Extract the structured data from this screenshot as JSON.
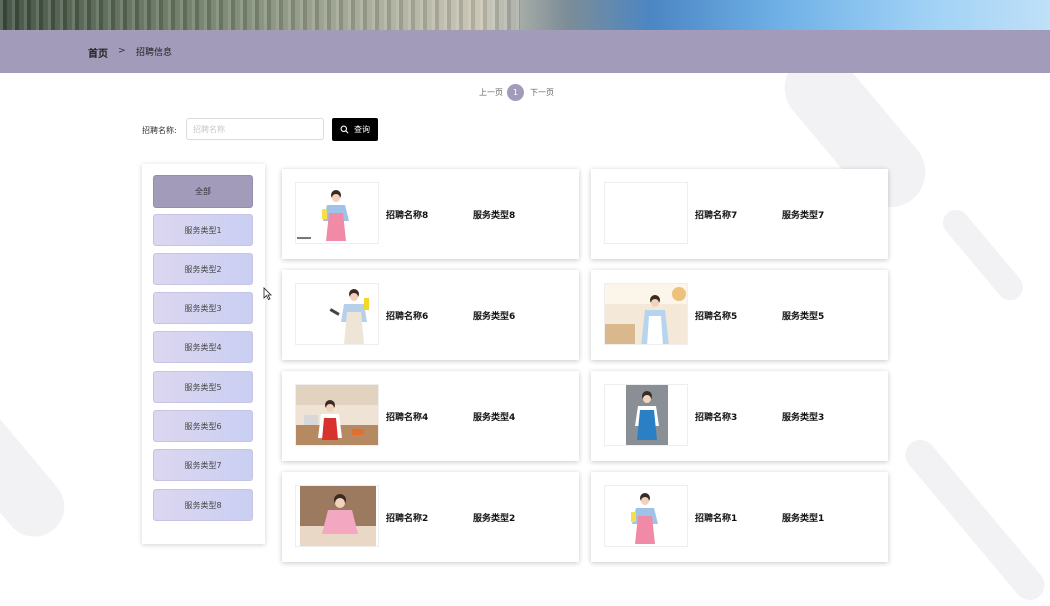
{
  "breadcrumb": {
    "home": "首页",
    "separator": ">",
    "current": "招聘信息"
  },
  "pagination": {
    "prev": "上一页",
    "current_page": "1",
    "next": "下一页"
  },
  "search": {
    "label": "招聘名称:",
    "placeholder": "招聘名称",
    "value": "",
    "button": "查询"
  },
  "categories": [
    "全部",
    "服务类型1",
    "服务类型2",
    "服务类型3",
    "服务类型4",
    "服务类型5",
    "服务类型6",
    "服务类型7",
    "服务类型8"
  ],
  "cards": [
    {
      "name": "招聘名称8",
      "type": "服务类型8"
    },
    {
      "name": "招聘名称7",
      "type": "服务类型7"
    },
    {
      "name": "招聘名称6",
      "type": "服务类型6"
    },
    {
      "name": "招聘名称5",
      "type": "服务类型5"
    },
    {
      "name": "招聘名称4",
      "type": "服务类型4"
    },
    {
      "name": "招聘名称3",
      "type": "服务类型3"
    },
    {
      "name": "招聘名称2",
      "type": "服务类型2"
    },
    {
      "name": "招聘名称1",
      "type": "服务类型1"
    }
  ],
  "colors": {
    "nav": "#a39bba",
    "accent_button": "#000000",
    "category_gradient_start": "#ddd6f0",
    "category_gradient_end": "#c9cff2"
  }
}
